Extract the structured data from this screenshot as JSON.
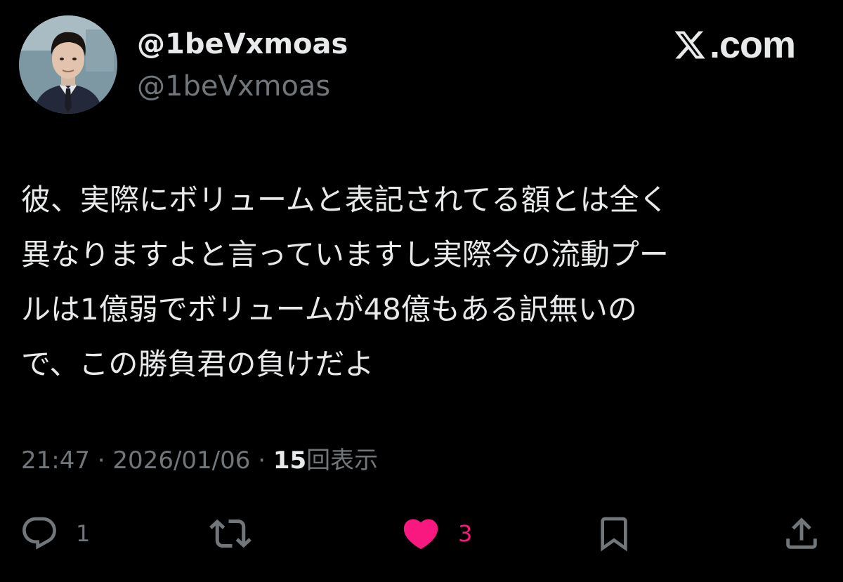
{
  "author": {
    "display_name": "@1beVxmoas",
    "handle": "@1beVxmoas"
  },
  "brand": {
    "label": ".com",
    "icon": "x-logo-icon"
  },
  "tweet": {
    "lines": [
      "彼、実際にボリュームと表記されてる額とは全く",
      "異なりますよと言っていますし実際今の流動プー",
      "ルは1億弱でボリュームが48億もある訳無いの",
      "で、この勝負君の負けだよ"
    ]
  },
  "meta": {
    "time": "21:47",
    "separator": "·",
    "date": "2026/01/06",
    "views_count": "15",
    "views_label": "回表示"
  },
  "actions": {
    "reply": {
      "icon": "reply-icon",
      "count": "1"
    },
    "retweet": {
      "icon": "retweet-icon",
      "count": ""
    },
    "like": {
      "icon": "heart-icon",
      "count": "3",
      "color": "#f91880"
    },
    "bookmark": {
      "icon": "bookmark-icon"
    },
    "share": {
      "icon": "share-icon"
    }
  },
  "colors": {
    "background": "#000000",
    "primary_text": "#e7e9ea",
    "secondary_text": "#71767b",
    "like": "#f91880"
  }
}
